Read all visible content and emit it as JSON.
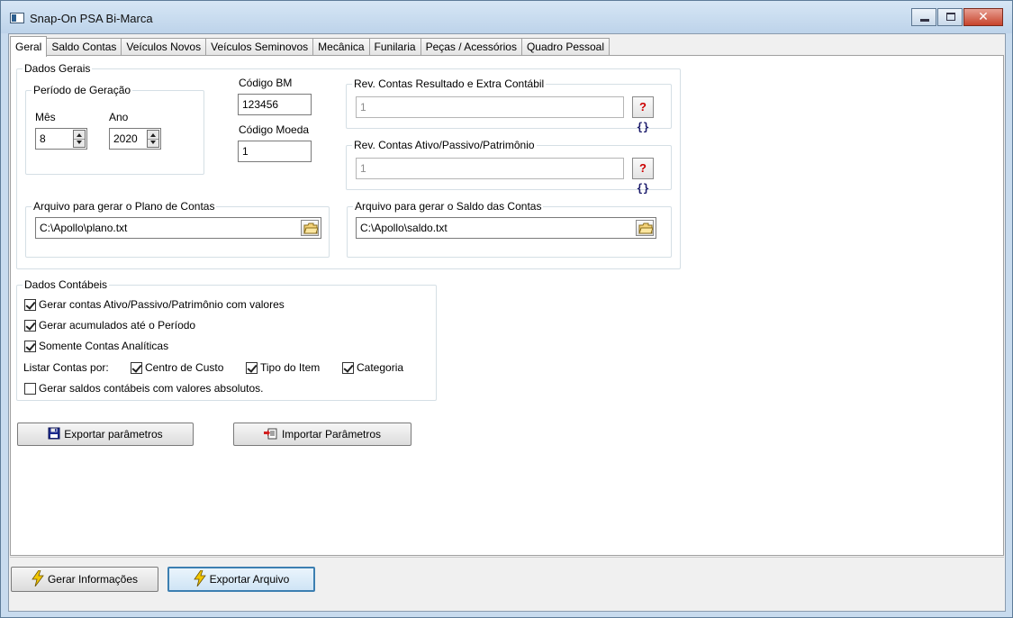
{
  "window": {
    "title": "Snap-On PSA Bi-Marca",
    "min_label": "",
    "max_label": "",
    "close_label": "✕"
  },
  "tabs": [
    {
      "label": "Geral"
    },
    {
      "label": "Saldo Contas"
    },
    {
      "label": "Veículos Novos"
    },
    {
      "label": "Veículos Seminovos"
    },
    {
      "label": "Mecânica"
    },
    {
      "label": "Funilaria"
    },
    {
      "label": "Peças / Acessórios"
    },
    {
      "label": "Quadro Pessoal"
    }
  ],
  "dados_gerais": {
    "legend": "Dados Gerais",
    "periodo": {
      "legend": "Período de Geração",
      "mes_label": "Mês",
      "mes_value": "8",
      "ano_label": "Ano",
      "ano_value": "2020"
    },
    "codigo_bm_label": "Código BM",
    "codigo_bm_value": "123456",
    "codigo_moeda_label": "Código Moeda",
    "codigo_moeda_value": "1",
    "rev_resultado": {
      "legend": "Rev. Contas Resultado e Extra Contábil",
      "value": "1",
      "help_q": "?",
      "help_b": "{}"
    },
    "rev_ativo": {
      "legend": "Rev. Contas Ativo/Passivo/Patrimônio",
      "value": "1",
      "help_q": "?",
      "help_b": "{}"
    },
    "plano": {
      "legend": "Arquivo para gerar o Plano de Contas",
      "value": "C:\\Apollo\\plano.txt"
    },
    "saldo": {
      "legend": "Arquivo para gerar o Saldo das Contas",
      "value": "C:\\Apollo\\saldo.txt"
    }
  },
  "dados_contabeis": {
    "legend": "Dados Contábeis",
    "chk_ativo": {
      "label": "Gerar contas Ativo/Passivo/Patrimônio com valores",
      "checked": true
    },
    "chk_acumulados": {
      "label": "Gerar acumulados até o Período",
      "checked": true
    },
    "chk_analiticas": {
      "label": "Somente Contas Analíticas",
      "checked": true
    },
    "listar_label": "Listar Contas por:",
    "chk_centro": {
      "label": "Centro de Custo",
      "checked": true
    },
    "chk_tipo": {
      "label": "Tipo do Item",
      "checked": true
    },
    "chk_categoria": {
      "label": "Categoria",
      "checked": true
    },
    "chk_absolutos": {
      "label": "Gerar saldos contábeis com valores absolutos.",
      "checked": false
    }
  },
  "buttons": {
    "exportar_parametros": "Exportar parâmetros",
    "importar_parametros": "Importar Parâmetros",
    "gerar_informacoes": "Gerar Informações",
    "exportar_arquivo": "Exportar Arquivo"
  },
  "icons": {
    "accent": "#3c7fb1",
    "lightning_color": "#f2c700"
  }
}
